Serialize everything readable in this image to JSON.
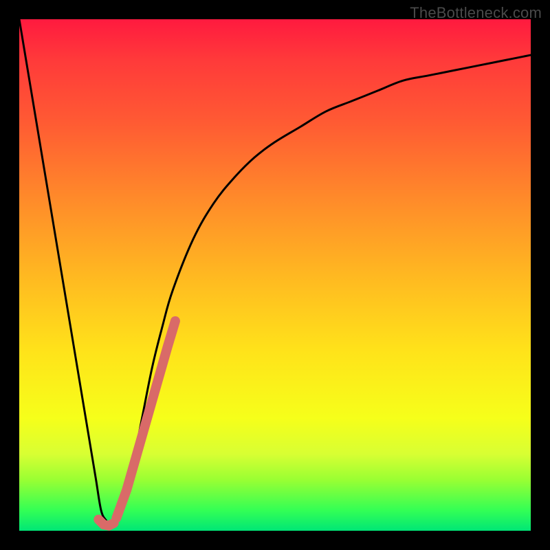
{
  "watermark": "TheBottleneck.com",
  "chart_data": {
    "type": "line",
    "title": "",
    "xlabel": "",
    "ylabel": "",
    "xlim": [
      0,
      100
    ],
    "ylim": [
      0,
      100
    ],
    "grid": false,
    "series": [
      {
        "name": "curve",
        "color": "#000000",
        "x": [
          0,
          5,
          10,
          13,
          14,
          15,
          16,
          17,
          18,
          19,
          20,
          22,
          24,
          26,
          28,
          30,
          34,
          38,
          42,
          46,
          50,
          55,
          60,
          65,
          70,
          75,
          80,
          85,
          90,
          95,
          100
        ],
        "values": [
          100,
          70,
          40,
          22,
          16,
          10,
          4,
          2,
          1,
          2,
          4,
          12,
          22,
          32,
          40,
          47,
          57,
          64,
          69,
          73,
          76,
          79,
          82,
          84,
          86,
          88,
          89,
          90,
          91,
          92,
          93
        ]
      },
      {
        "name": "highlight-segment",
        "color": "#d96a68",
        "x": [
          19,
          21,
          23,
          25,
          27,
          29,
          30.5
        ],
        "values": [
          2.5,
          8,
          15,
          22,
          29,
          36,
          41
        ]
      },
      {
        "name": "highlight-bottom",
        "color": "#d96a68",
        "x": [
          15.5,
          16.5,
          17.5,
          18.5
        ],
        "values": [
          2.2,
          1.2,
          1.0,
          1.5
        ]
      }
    ]
  }
}
